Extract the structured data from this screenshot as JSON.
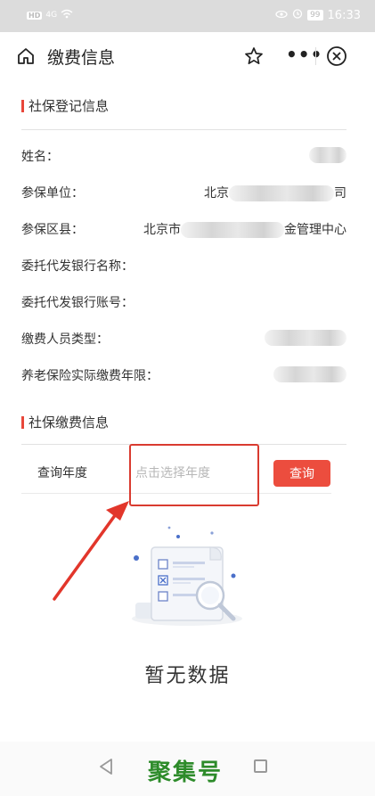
{
  "status_bar": {
    "network": "HD",
    "signal": "4G",
    "battery": "99",
    "time": "16:33"
  },
  "header": {
    "title": "缴费信息"
  },
  "registration": {
    "section_title": "社保登记信息",
    "rows": [
      {
        "label": "姓名：",
        "value_prefix": "",
        "value_suffix": ""
      },
      {
        "label": "参保单位：",
        "value_prefix": "北京",
        "value_suffix": "司"
      },
      {
        "label": "参保区县：",
        "value_prefix": "北京市",
        "value_suffix": "金管理中心"
      },
      {
        "label": "委托代发银行名称：",
        "value_prefix": "",
        "value_suffix": ""
      },
      {
        "label": "委托代发银行账号：",
        "value_prefix": "",
        "value_suffix": ""
      },
      {
        "label": "缴费人员类型：",
        "value_prefix": "",
        "value_suffix": ""
      },
      {
        "label": "养老保险实际缴费年限：",
        "value_prefix": "",
        "value_suffix": ""
      }
    ]
  },
  "payment": {
    "section_title": "社保缴费信息",
    "query_label": "查询年度",
    "year_placeholder": "点击选择年度",
    "query_button": "查询"
  },
  "empty_state": {
    "text": "暂无数据"
  },
  "watermark": "聚集号",
  "colors": {
    "accent": "#ec4d3e",
    "highlight": "#d93b30",
    "watermark": "#2d8b2a"
  }
}
